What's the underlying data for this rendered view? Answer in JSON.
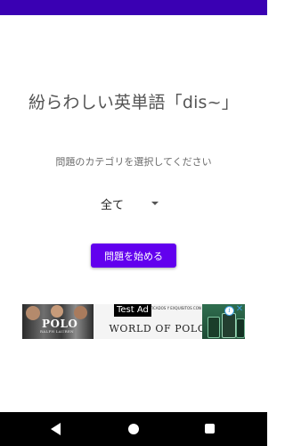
{
  "colors": {
    "status_bar": "#3a00b3",
    "primary": "#6200ee",
    "navigation_bar": "#000000"
  },
  "main": {
    "title": "紛らわしい英単語「dis~」",
    "subtitle": "問題のカテゴリを選択してください",
    "category_selector": {
      "selected_value": "全て"
    },
    "start_button_label": "問題を始める"
  },
  "ad": {
    "test_label": "Test Ad",
    "logo": "POLO",
    "logo_sub": "RALPH LAUREN",
    "copy_small": "UNDO DE ARO… FISTICADOS Y EXQUISITOS CON",
    "headline": "WORLD OF POLO",
    "info_icon": "info-icon",
    "close_icon": "close-icon"
  },
  "navigation_bar": {
    "back_icon": "back-triangle-icon",
    "home_icon": "home-circle-icon",
    "recents_icon": "recents-square-icon"
  }
}
